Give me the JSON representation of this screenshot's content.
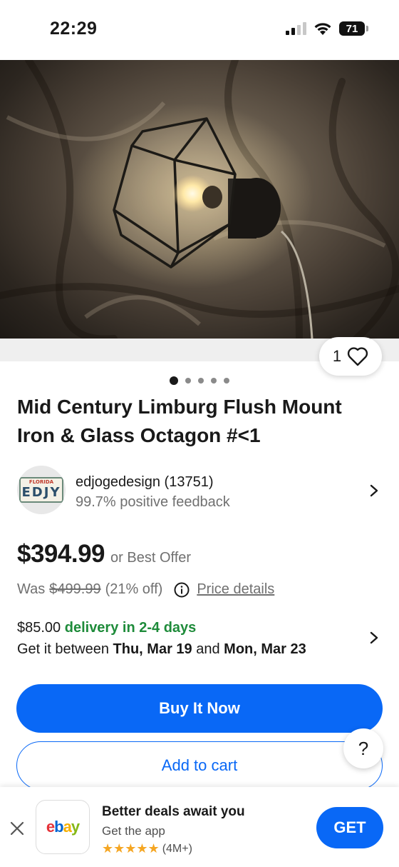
{
  "status_bar": {
    "time": "22:29",
    "battery": "71"
  },
  "gallery": {
    "like_count": "1",
    "total_images": 5,
    "active_index": 0
  },
  "listing": {
    "title": "Mid Century Limburg Flush Mount Iron & Glass Octagon #<1"
  },
  "seller": {
    "avatar_top_text": "FLORIDA",
    "avatar_plate_text": "EDJY",
    "name": "edjogedesign (13751)",
    "feedback": "99.7% positive feedback"
  },
  "price": {
    "amount": "$394.99",
    "offer_label": "or Best Offer",
    "was_label": "Was",
    "was_amount": "$499.99",
    "discount": "(21% off)",
    "details_link": "Price details"
  },
  "delivery": {
    "cost": "$85.00",
    "speed": "delivery in 2-4 days",
    "window_prefix": "Get it between",
    "date_start": "Thu, Mar 19",
    "window_and": "and",
    "date_end": "Mon, Mar 23"
  },
  "actions": {
    "buy_now": "Buy It Now",
    "add_to_cart": "Add to cart",
    "help": "?"
  },
  "app_banner": {
    "title": "Better deals await you",
    "subtitle": "Get the app",
    "stars": "★★★★★",
    "rating_count": "(4M+)",
    "get_label": "GET"
  },
  "colors": {
    "primary_blue": "#0968f6",
    "delivery_green": "#1e8b3a",
    "text_dark": "#191919",
    "text_muted": "#707070"
  }
}
